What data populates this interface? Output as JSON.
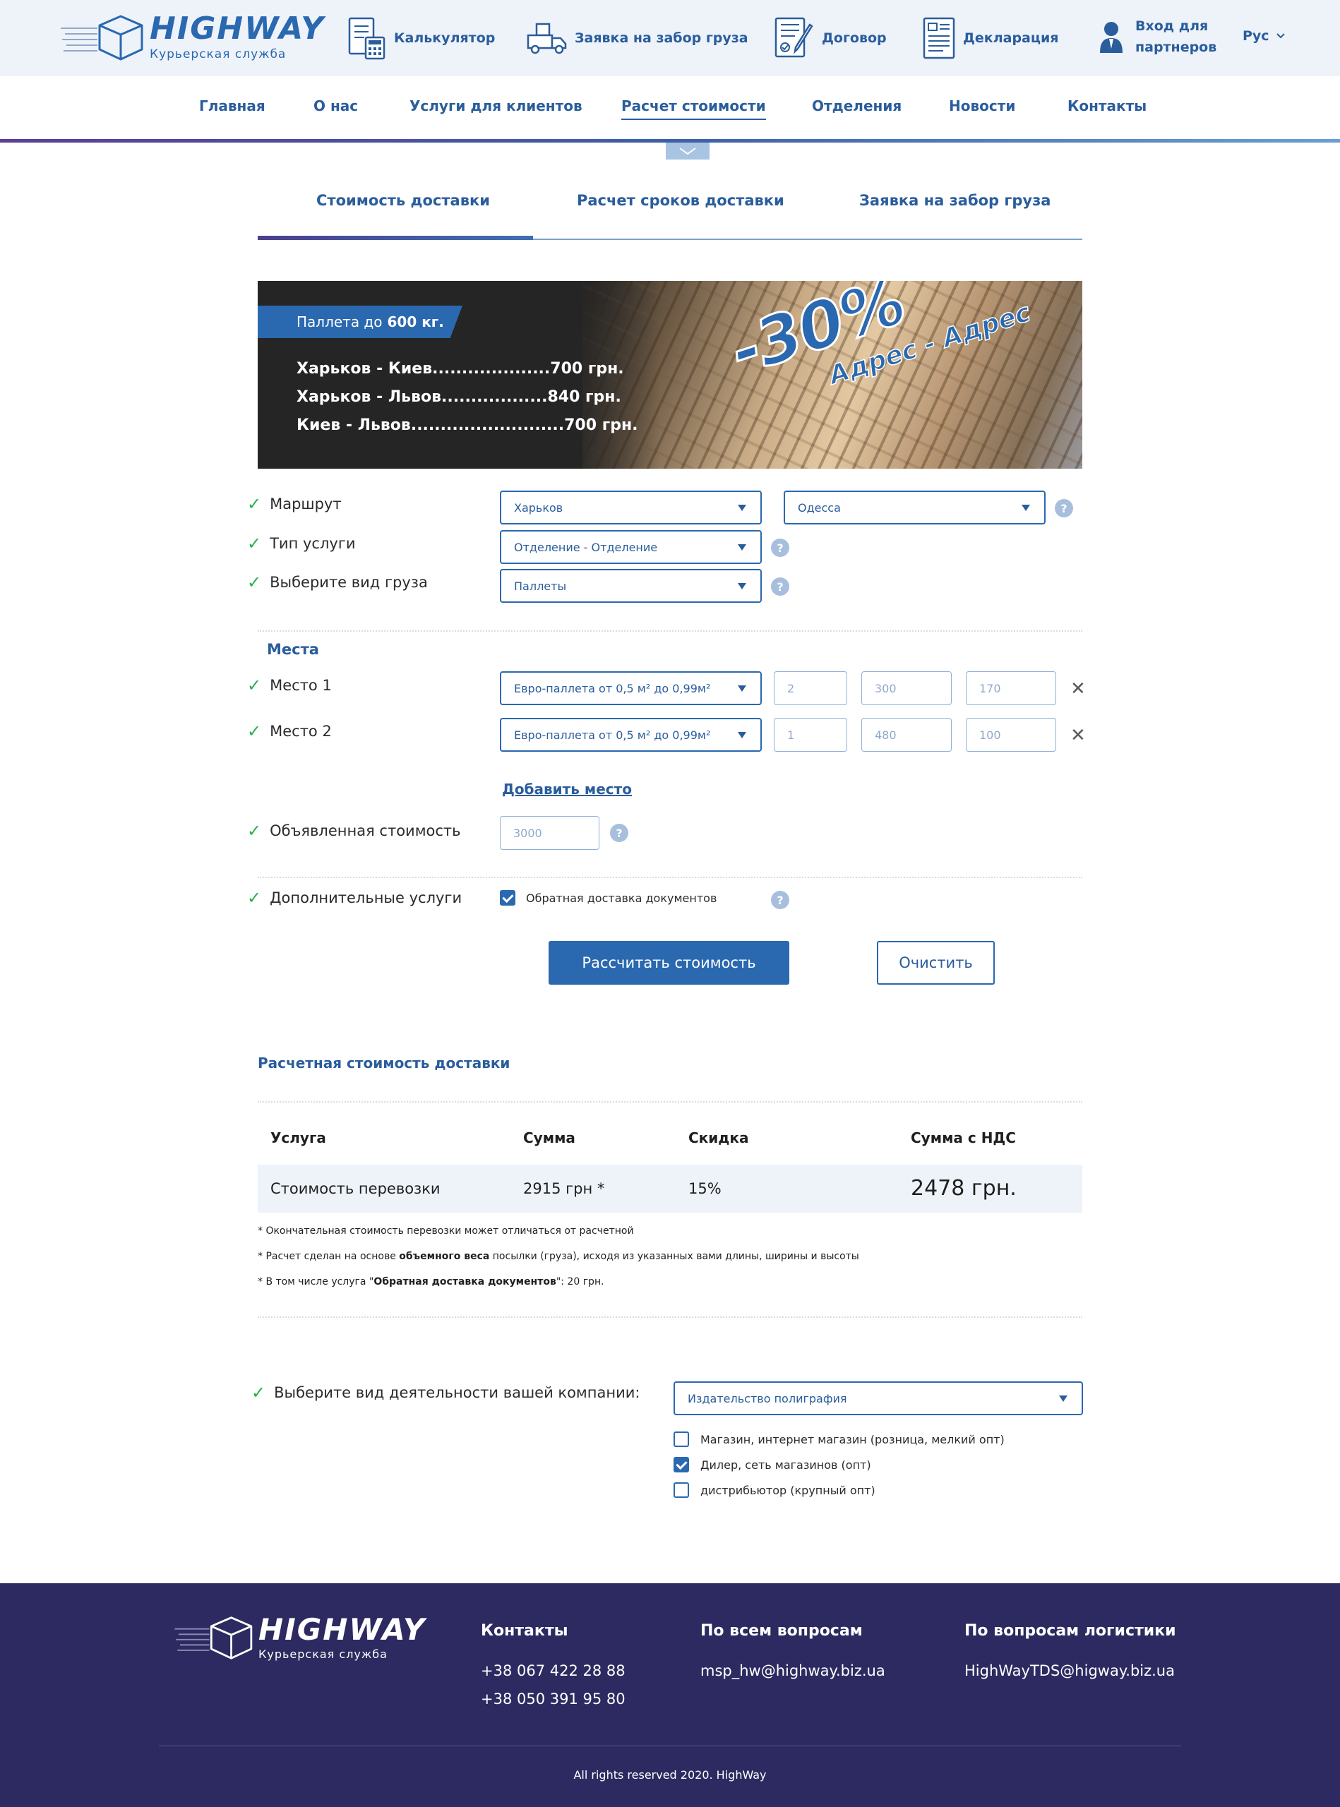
{
  "brand": {
    "name": "HIGHWAY",
    "subtitle": "Курьерская служба"
  },
  "header": {
    "items": [
      {
        "label": "Калькулятор",
        "icon": "calculator-icon"
      },
      {
        "label": "Заявка на забор груза",
        "icon": "truck-icon"
      },
      {
        "label": "Договор",
        "icon": "contract-icon"
      },
      {
        "label": "Декларация",
        "icon": "declaration-icon"
      }
    ],
    "partners": {
      "line1": "Вход для",
      "line2": "партнеров",
      "icon": "user-icon"
    },
    "language": "Рус"
  },
  "nav": {
    "items": [
      "Главная",
      "О нас",
      "Услуги для клиентов",
      "Расчет стоимости",
      "Отделения",
      "Новости",
      "Контакты"
    ],
    "active": "Расчет стоимости"
  },
  "tabs": [
    "Стоимость доставки",
    "Расчет сроков доставки",
    "Заявка на забор груза"
  ],
  "banner": {
    "ribbon_prefix": "Паллета до",
    "ribbon_bold": "600 кг.",
    "prices": [
      "Харьков - Киев....................700 грн.",
      "Харьков - Львов..................840 грн.",
      "Киев - Львов..........................700 грн."
    ],
    "discount": "-30%",
    "discount_sub": "Адрес - Адрес"
  },
  "form": {
    "route_label": "Маршрут",
    "route_from": "Харьков",
    "route_to": "Одесса",
    "service_label": "Тип услуги",
    "service_value": "Отделение - Отделение",
    "cargo_label": "Выберите вид груза",
    "cargo_value": "Паллеты",
    "places_title": "Места",
    "places": [
      {
        "label": "Место 1",
        "type": "Евро-паллета от 0,5 м² до 0,99м²",
        "count": "2",
        "weight": "300",
        "height": "170"
      },
      {
        "label": "Место 2",
        "type": "Евро-паллета от 0,5 м² до 0,99м²",
        "count": "1",
        "weight": "480",
        "height": "100"
      }
    ],
    "add_place": "Добавить место",
    "declared_label": "Объявленная стоимость",
    "declared_value": "3000",
    "extra_label": "Дополнительные услуги",
    "extra_option": "Обратная доставка документов",
    "extra_checked": true,
    "calc_button": "Рассчитать стоимость",
    "clear_button": "Очистить",
    "help_mark": "?",
    "check_mark": "✓",
    "remove_mark": "✕"
  },
  "results": {
    "title": "Расчетная стоимость доставки",
    "headers": [
      "Услуга",
      "Сумма",
      "Скидка",
      "Сумма с НДС"
    ],
    "row": {
      "service": "Стоимость перевозки",
      "sum": "2915 грн *",
      "discount": "15%",
      "sum_vat": "2478 грн."
    },
    "notes": {
      "n1": "* Окончательная стоимость перевозки может отличаться от расчетной",
      "n2_pre": "* Расчет сделан на основе ",
      "n2_bold": "объемного веса",
      "n2_post": " посылки (груза), исходя из указанных вами длины, ширины и высоты",
      "n3_pre": "* В том числе услуга \"",
      "n3_bold": "Обратная доставка документов",
      "n3_post": "\": 20 грн."
    }
  },
  "activity": {
    "label": "Выберите вид деятельности вашей компании:",
    "selected": "Издательство полиграфия",
    "options": [
      {
        "label": "Магазин, интернет магазин (розница, мелкий опт)",
        "checked": false
      },
      {
        "label": "Дилер, сеть магазинов (опт)",
        "checked": true
      },
      {
        "label": "дистрибьютор (крупный опт)",
        "checked": false
      }
    ]
  },
  "footer": {
    "contacts_title": "Контакты",
    "phones": [
      "+38 067 422 28 88",
      "+38 050 391 95 80"
    ],
    "general_title": "По всем вопросам",
    "general_email": "msp_hw@highway.biz.ua",
    "logistics_title": "По вопросам логистики",
    "logistics_email": "HighWayTDS@higway.biz.ua",
    "copyright": "All rights reserved 2020. HighWay"
  },
  "colors": {
    "brand": "#2a68b0",
    "header_bg": "#eef3fa",
    "footer_bg": "#2c2a60",
    "check": "#28b14c"
  }
}
